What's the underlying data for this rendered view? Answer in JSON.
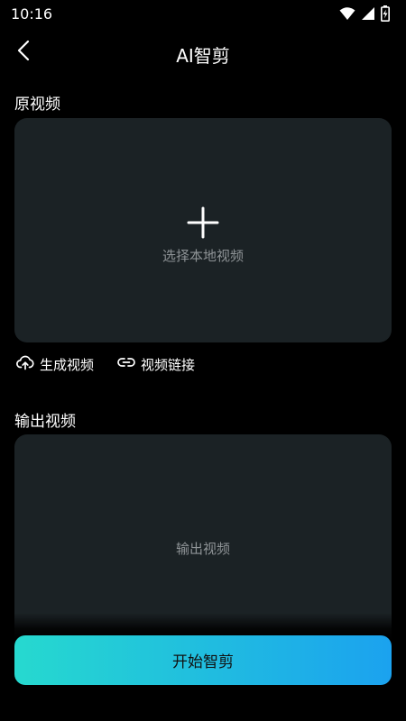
{
  "status_bar": {
    "time": "10:16",
    "icons": [
      "wifi-icon",
      "signal-icon",
      "battery-charging-icon"
    ]
  },
  "header": {
    "title": "AI智剪",
    "back_icon": "chevron-left-icon"
  },
  "source_section": {
    "label": "原视频",
    "upload_hint": "选择本地视频",
    "upload_icon": "plus-icon"
  },
  "actions": [
    {
      "icon": "cloud-upload-icon",
      "label": "生成视频"
    },
    {
      "icon": "link-icon",
      "label": "视频链接"
    }
  ],
  "output_section": {
    "label": "输出视频",
    "placeholder": "输出视频"
  },
  "start_button": {
    "label": "开始智剪"
  },
  "colors": {
    "background": "#000000",
    "panel": "#1b2225",
    "hint_text": "#8e9396",
    "button_gradient_start": "#26d9cf",
    "button_gradient_end": "#1ba2ef"
  }
}
